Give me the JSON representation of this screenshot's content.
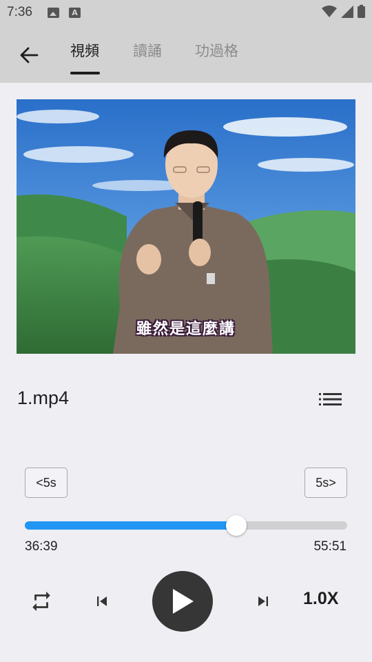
{
  "status_bar": {
    "time": "7:36",
    "left_icons": [
      "image-icon",
      "text-a-icon"
    ],
    "right_icons": [
      "wifi-icon",
      "signal-icon",
      "battery-icon"
    ],
    "text_icon_label": "A"
  },
  "header": {
    "tabs": [
      {
        "label": "視頻",
        "active": true
      },
      {
        "label": "讀誦",
        "active": false
      },
      {
        "label": "功過格",
        "active": false
      }
    ]
  },
  "video": {
    "subtitle": "雖然是這麼講"
  },
  "player": {
    "file_name": "1.mp4",
    "rewind_label": "<5s",
    "forward_label": "5s>",
    "elapsed": "36:39",
    "duration": "55:51",
    "progress_fraction": 0.657,
    "speed": "1.0X"
  },
  "colors": {
    "accent": "#2196f3",
    "header_bg": "#d2d2d2",
    "page_bg": "#efeef3",
    "play_button": "#363636"
  }
}
